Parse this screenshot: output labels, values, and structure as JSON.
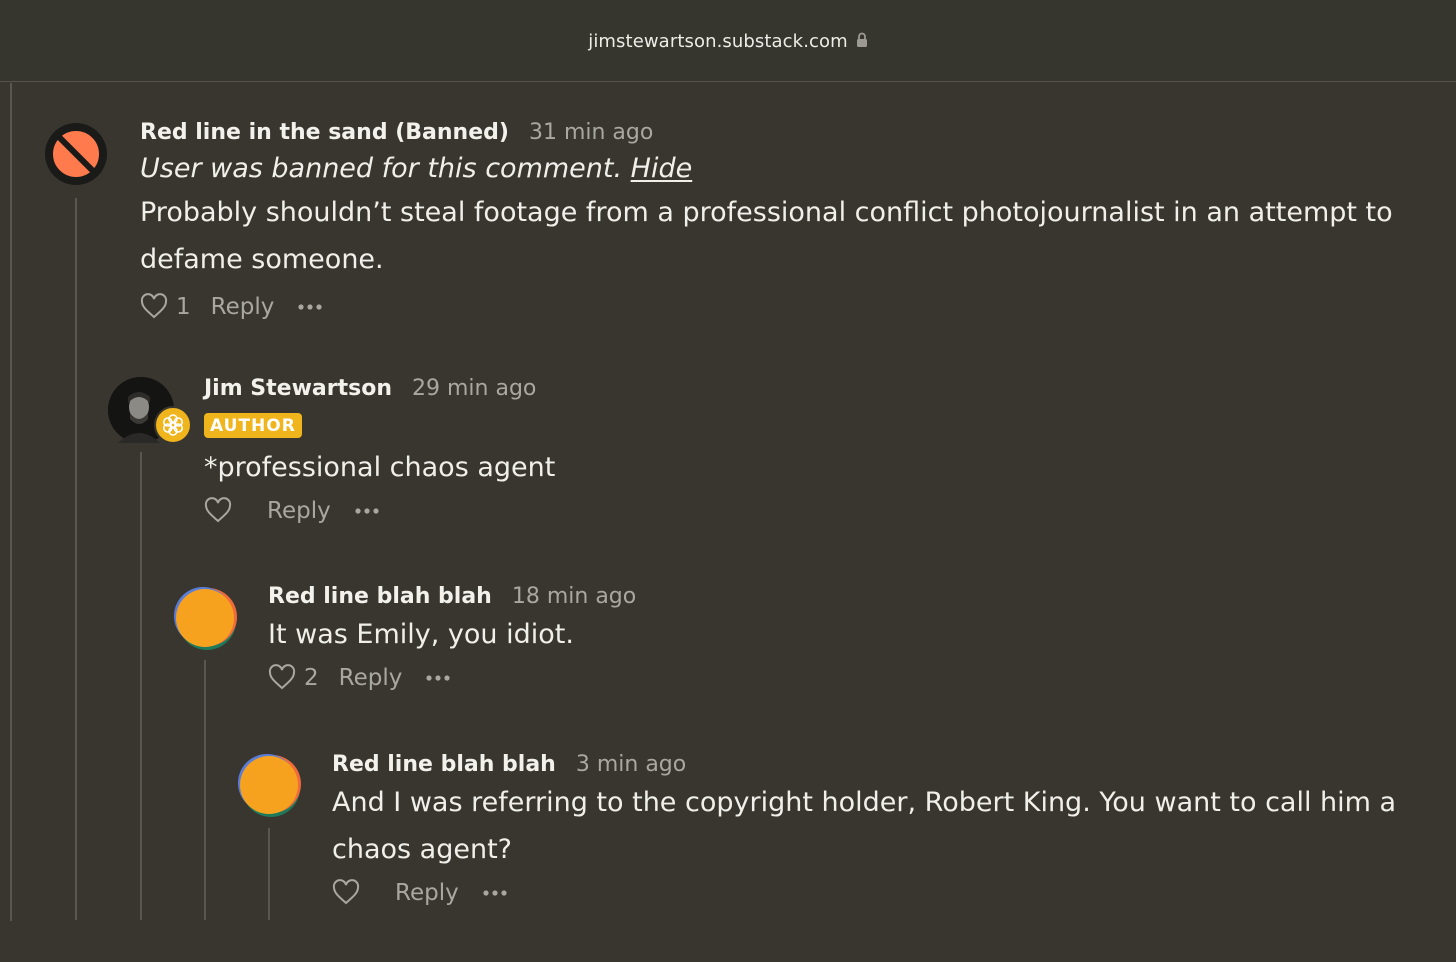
{
  "browser": {
    "url": "jimstewartson.substack.com",
    "lock_icon": "lock-icon"
  },
  "colors": {
    "background": "#38362f",
    "badge": "#f0b41c",
    "muted_text": "#a9a7a0"
  },
  "comments": [
    {
      "author": "Red line in the sand (Banned)",
      "time": "31 min ago",
      "avatar": "banned-icon",
      "banned_note": "User was banned for this comment.",
      "hide_label": "Hide",
      "body": "Probably shouldn’t steal footage from a professional conflict photojournalist in an attempt to defame someone.",
      "likes": "1",
      "reply_label": "Reply"
    },
    {
      "author": "Jim Stewartson",
      "time": "29 min ago",
      "avatar": "author-avatar",
      "badge": "AUTHOR",
      "body": "*professional chaos agent",
      "likes": "",
      "reply_label": "Reply"
    },
    {
      "author": "Red line blah blah",
      "time": "18 min ago",
      "avatar": "default-avatar",
      "body": "It was Emily, you idiot.",
      "likes": "2",
      "reply_label": "Reply"
    },
    {
      "author": "Red line blah blah",
      "time": "3 min ago",
      "avatar": "default-avatar",
      "body": "And I was referring to the copyright holder, Robert King. You want to call him a chaos agent?",
      "likes": "",
      "reply_label": "Reply"
    }
  ]
}
